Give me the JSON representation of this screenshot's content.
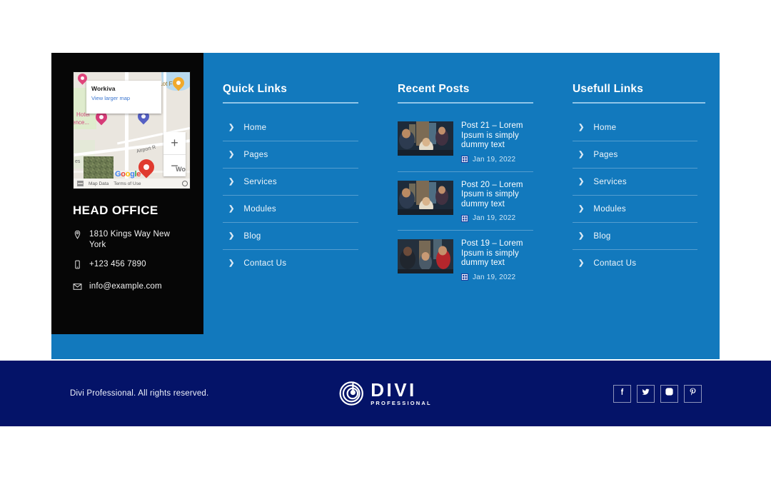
{
  "colors": {
    "footer_blue": "#1279bd",
    "panel_black": "#060606",
    "bottom_navy": "#041368",
    "rule_light_blue": "#8fc5e8",
    "date_text": "#cfe6f6"
  },
  "contact": {
    "map": {
      "card_title": "Workiva",
      "card_link": "View larger map",
      "labels": {
        "lot": "s Lot F",
        "hotel": "Hotel",
        "ence": "ence...",
        "airport": "Airport R",
        "wc": "Wo",
        "es": "es"
      },
      "zoom_in": "+",
      "zoom_out": "−",
      "watermark": [
        "G",
        "o",
        "o",
        "g",
        "l",
        "e"
      ],
      "map_data": "Map Data",
      "terms": "Terms of Use"
    },
    "title": "HEAD OFFICE",
    "items": [
      {
        "icon": "location-icon",
        "text": "1810 Kings Way New York"
      },
      {
        "icon": "phone-icon",
        "text": "+123 456 7890"
      },
      {
        "icon": "mail-icon",
        "text": "info@example.com"
      }
    ]
  },
  "quick_links": {
    "title": "Quick Links",
    "items": [
      {
        "label": "Home"
      },
      {
        "label": "Pages"
      },
      {
        "label": "Services"
      },
      {
        "label": "Modules"
      },
      {
        "label": "Blog"
      },
      {
        "label": "Contact Us"
      }
    ]
  },
  "recent_posts": {
    "title": "Recent Posts",
    "items": [
      {
        "title": "Post 21 – Lorem Ipsum is simply dummy text",
        "date": "Jan 19, 2022"
      },
      {
        "title": "Post 20 – Lorem Ipsum is simply dummy text",
        "date": "Jan 19, 2022"
      },
      {
        "title": "Post 19 – Lorem Ipsum is simply dummy text",
        "date": "Jan 19, 2022"
      }
    ]
  },
  "useful_links": {
    "title": "Usefull Links",
    "items": [
      {
        "label": "Home"
      },
      {
        "label": "Pages"
      },
      {
        "label": "Services"
      },
      {
        "label": "Modules"
      },
      {
        "label": "Blog"
      },
      {
        "label": "Contact Us"
      }
    ]
  },
  "bottom_bar": {
    "copyright": "Divi Professional. All rights reserved.",
    "brand_name": "DIVI",
    "brand_sub": "PROFESSIONAL",
    "socials": [
      {
        "name": "facebook-icon"
      },
      {
        "name": "twitter-icon"
      },
      {
        "name": "instagram-icon"
      },
      {
        "name": "pinterest-icon"
      }
    ]
  }
}
